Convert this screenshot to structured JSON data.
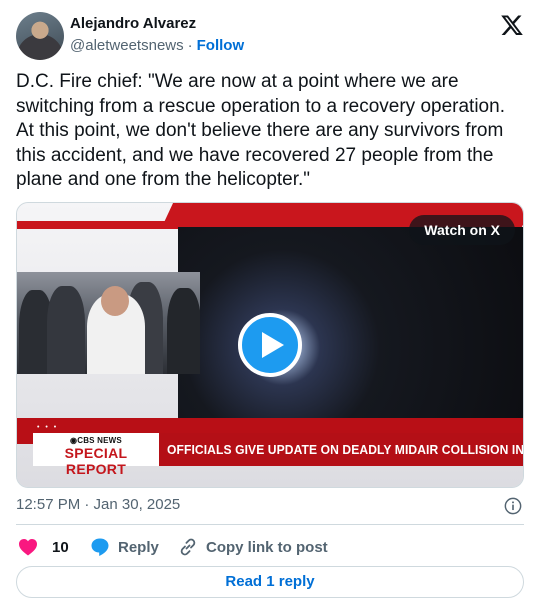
{
  "author": {
    "name": "Alejandro Alvarez",
    "handle": "@aletweetsnews",
    "separator": "·",
    "follow_label": "Follow"
  },
  "tweet": {
    "text": "D.C. Fire chief: \"We are now at a point where we are switching from a rescue operation to a recovery operation. At this point, we don't believe there are any survivors from this accident, and we have recovered 27 people from the plane and one from the helicopter.\""
  },
  "media": {
    "watch_label": "Watch on X",
    "cbs_logo": "◉CBS NEWS",
    "special_report": "SPECIAL REPORT",
    "headline": "OFFICIALS GIVE UPDATE ON DEADLY MIDAIR COLLISION IN DC",
    "dots": "• • •"
  },
  "meta": {
    "timestamp": "12:57 PM · Jan 30, 2025"
  },
  "actions": {
    "like_count": "10",
    "reply_label": "Reply",
    "copy_label": "Copy link to post"
  },
  "read_reply_label": "Read 1 reply",
  "colors": {
    "accent": "#1d9bf0",
    "link": "#006fd6",
    "like": "#f91880",
    "cbs_red": "#b40f16"
  }
}
